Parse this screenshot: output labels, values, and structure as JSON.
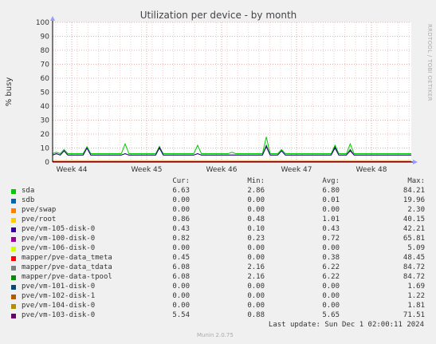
{
  "chart_data": {
    "type": "line",
    "title": "Utilization per device - by month",
    "ylabel": "% busy",
    "ylim": [
      0,
      100
    ],
    "yticks": [
      0,
      10,
      20,
      30,
      40,
      50,
      60,
      70,
      80,
      90,
      100
    ],
    "x_tick_labels": [
      "Week 44",
      "Week 45",
      "Week 46",
      "Week 47",
      "Week 48"
    ],
    "grid": true,
    "side_label": "RRDTOOL / TOBI OETIKER",
    "series": [
      {
        "name": "sda",
        "color": "#00cc00",
        "values": [
          6,
          7,
          6,
          9,
          6,
          6,
          6,
          6,
          6,
          11,
          6,
          6,
          6,
          6,
          6,
          6,
          6,
          6,
          6,
          13,
          6,
          6,
          6,
          6,
          6,
          6,
          6,
          6,
          11,
          6,
          6,
          6,
          6,
          6,
          6,
          6,
          6,
          6,
          12,
          6,
          6,
          6,
          6,
          6,
          6,
          6,
          6,
          7,
          6,
          6,
          6,
          6,
          6,
          6,
          6,
          6,
          18,
          6,
          6,
          6,
          9,
          6,
          6,
          6,
          6,
          6,
          6,
          6,
          6,
          6,
          6,
          6,
          6,
          6,
          12,
          6,
          6,
          6,
          13,
          6,
          6,
          6,
          6,
          6,
          6,
          6,
          6,
          6,
          6,
          6,
          6,
          6,
          6,
          6,
          6
        ]
      },
      {
        "name": "mapper/pve-data-tpool",
        "color": "#006600",
        "values": [
          5,
          6,
          5,
          8,
          5,
          5,
          5,
          5,
          5,
          10,
          5,
          5,
          5,
          5,
          5,
          5,
          5,
          5,
          5,
          6,
          5,
          5,
          5,
          5,
          5,
          5,
          5,
          5,
          11,
          5,
          5,
          5,
          5,
          5,
          5,
          5,
          5,
          5,
          6,
          5,
          5,
          5,
          5,
          5,
          5,
          5,
          5,
          5,
          5,
          5,
          5,
          5,
          5,
          5,
          5,
          5,
          12,
          5,
          5,
          5,
          8,
          5,
          5,
          5,
          5,
          5,
          5,
          5,
          5,
          5,
          5,
          5,
          5,
          5,
          11,
          5,
          5,
          5,
          9,
          5,
          5,
          5,
          5,
          5,
          5,
          5,
          5,
          5,
          5,
          5,
          5,
          5,
          5,
          5,
          5
        ]
      },
      {
        "name": "pve/vm-103-disk-0",
        "color": "#330099",
        "values": [
          5,
          6,
          5,
          8,
          5,
          5,
          5,
          5,
          5,
          10,
          5,
          5,
          5,
          5,
          5,
          5,
          5,
          5,
          5,
          6,
          5,
          5,
          5,
          5,
          5,
          5,
          5,
          5,
          10,
          5,
          5,
          5,
          5,
          5,
          5,
          5,
          5,
          5,
          6,
          5,
          5,
          5,
          5,
          5,
          5,
          5,
          5,
          5,
          5,
          5,
          5,
          5,
          5,
          5,
          5,
          5,
          11,
          5,
          5,
          5,
          8,
          5,
          5,
          5,
          5,
          5,
          5,
          5,
          5,
          5,
          5,
          5,
          5,
          5,
          10,
          5,
          5,
          5,
          8,
          5,
          5,
          5,
          5,
          5,
          5,
          5,
          5,
          5,
          5,
          5,
          5,
          5,
          5,
          5,
          5
        ]
      },
      {
        "name": "mapper/pve-data_tmeta",
        "color": "#ff0000",
        "values": [
          0.4,
          0.4,
          0.4,
          0.4,
          0.4,
          0.4,
          0.4,
          0.4,
          0.4,
          0.4,
          0.4,
          0.4,
          0.4,
          0.4,
          0.4,
          0.4,
          0.4,
          0.4,
          0.4,
          0.4,
          0.4,
          0.4,
          0.4,
          0.4,
          0.4,
          0.4,
          0.4,
          0.4,
          0.4,
          0.4,
          0.4,
          0.4,
          0.4,
          0.4,
          0.4,
          0.4,
          0.4,
          0.4,
          0.4,
          0.4,
          0.4,
          0.4,
          0.4,
          0.4,
          0.4,
          0.4,
          0.4,
          0.4,
          0.4,
          0.4,
          0.4,
          0.4,
          0.4,
          0.4,
          0.4,
          0.4,
          0.4,
          0.4,
          0.4,
          0.4,
          0.4,
          0.4,
          0.4,
          0.4,
          0.4,
          0.4,
          0.4,
          0.4,
          0.4,
          0.4,
          0.4,
          0.4,
          0.4,
          0.4,
          0.4,
          0.4,
          0.4,
          0.4,
          0.4,
          0.4,
          0.4,
          0.4,
          0.4,
          0.4,
          0.4,
          0.4,
          0.4,
          0.4,
          0.4,
          0.4,
          0.4,
          0.4,
          0.4,
          0.4,
          0.4
        ]
      },
      {
        "name": "pve/root",
        "color": "#ffcc00",
        "values": [
          1,
          1,
          1,
          1,
          1,
          1,
          1,
          1,
          1,
          1,
          1,
          1,
          1,
          1,
          1,
          1,
          1,
          1,
          1,
          1,
          1,
          1,
          1,
          1,
          1,
          1,
          1,
          1,
          1,
          1,
          1,
          1,
          1,
          1,
          1,
          1,
          1,
          1,
          1,
          1,
          1,
          1,
          1,
          1,
          1,
          1,
          1,
          1,
          1,
          1,
          1,
          1,
          1,
          1,
          1,
          1,
          1,
          1,
          1,
          1,
          1,
          1,
          1,
          1,
          1,
          1,
          1,
          1,
          1,
          1,
          1,
          1,
          1,
          1,
          1,
          1,
          1,
          1,
          1,
          1,
          1,
          1,
          1,
          1,
          1,
          1,
          1,
          1,
          1,
          1,
          1,
          1,
          1,
          1,
          1
        ]
      }
    ],
    "legend": {
      "headers": {
        "cur": "Cur:",
        "min": "Min:",
        "avg": "Avg:",
        "max": "Max:"
      },
      "rows": [
        {
          "name": "sda",
          "color": "#00cc00",
          "cur": "6.63",
          "min": "2.86",
          "avg": "6.80",
          "max": "84.21"
        },
        {
          "name": "sdb",
          "color": "#0066b3",
          "cur": "0.00",
          "min": "0.00",
          "avg": "0.01",
          "max": "19.96"
        },
        {
          "name": "pve/swap",
          "color": "#ff8000",
          "cur": "0.00",
          "min": "0.00",
          "avg": "0.00",
          "max": "2.30"
        },
        {
          "name": "pve/root",
          "color": "#ffcc00",
          "cur": "0.86",
          "min": "0.48",
          "avg": "1.01",
          "max": "40.15"
        },
        {
          "name": "pve/vm-105-disk-0",
          "color": "#330099",
          "cur": "0.43",
          "min": "0.10",
          "avg": "0.43",
          "max": "42.21"
        },
        {
          "name": "pve/vm-100-disk-0",
          "color": "#990099",
          "cur": "0.82",
          "min": "0.23",
          "avg": "0.72",
          "max": "65.81"
        },
        {
          "name": "pve/vm-106-disk-0",
          "color": "#ccff00",
          "cur": "0.00",
          "min": "0.00",
          "avg": "0.00",
          "max": "5.09"
        },
        {
          "name": "mapper/pve-data_tmeta",
          "color": "#ff0000",
          "cur": "0.45",
          "min": "0.00",
          "avg": "0.38",
          "max": "48.45"
        },
        {
          "name": "mapper/pve-data_tdata",
          "color": "#808080",
          "cur": "6.08",
          "min": "2.16",
          "avg": "6.22",
          "max": "84.72"
        },
        {
          "name": "mapper/pve-data-tpool",
          "color": "#008f00",
          "cur": "6.08",
          "min": "2.16",
          "avg": "6.22",
          "max": "84.72"
        },
        {
          "name": "pve/vm-101-disk-0",
          "color": "#00487d",
          "cur": "0.00",
          "min": "0.00",
          "avg": "0.00",
          "max": "1.69"
        },
        {
          "name": "pve/vm-102-disk-1",
          "color": "#b35a00",
          "cur": "0.00",
          "min": "0.00",
          "avg": "0.00",
          "max": "1.22"
        },
        {
          "name": "pve/vm-104-disk-0",
          "color": "#b38f00",
          "cur": "0.00",
          "min": "0.00",
          "avg": "0.00",
          "max": "1.81"
        },
        {
          "name": "pve/vm-103-disk-0",
          "color": "#6b006b",
          "cur": "5.54",
          "min": "0.88",
          "avg": "5.65",
          "max": "71.51"
        }
      ]
    },
    "last_update": "Last update:  Sun Dec  1 02:00:11 2024",
    "footer": "Munin 2.0.75"
  }
}
